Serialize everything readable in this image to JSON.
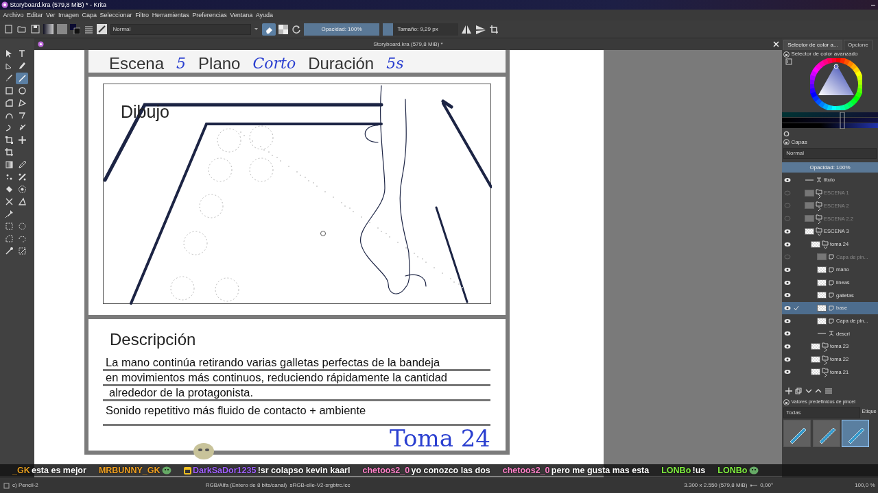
{
  "window": {
    "title": "Storyboard.kra (579,8 MiB) * - Krita"
  },
  "menu": [
    "Archivo",
    "Editar",
    "Ver",
    "Imagen",
    "Capa",
    "Seleccionar",
    "Filtro",
    "Herramientas",
    "Preferencias",
    "Ventana",
    "Ayuda"
  ],
  "toolbar": {
    "blend_mode": "Normal",
    "opacity": {
      "text": "Opacidad: 100%",
      "level": 1
    },
    "size": {
      "text": "Tamaño: 9,29 px",
      "level": 0.14
    }
  },
  "tools": [
    {
      "selected": false
    },
    {
      "selected": false
    },
    {
      "selected": false
    },
    {
      "selected": false
    },
    {
      "selected": false
    },
    {
      "selected": true
    },
    {
      "selected": false
    },
    {
      "selected": false
    },
    {
      "selected": false
    },
    {
      "selected": false
    },
    {
      "selected": false
    },
    {
      "selected": false
    },
    {
      "selected": false
    },
    {
      "selected": false
    },
    {
      "selected": false
    },
    {
      "selected": false
    },
    {
      "selected": false
    },
    {
      "selected": false
    },
    {
      "selected": false
    },
    {
      "selected": false
    },
    {
      "selected": false
    },
    {
      "selected": false
    },
    {
      "selected": false
    },
    {
      "selected": false
    },
    {
      "selected": false
    },
    {
      "selected": false
    },
    {
      "selected": false
    },
    {
      "selected": false
    },
    {
      "selected": false
    },
    {
      "selected": false
    },
    {
      "selected": false
    },
    {
      "selected": false
    }
  ],
  "document_tab": {
    "title": "Storyboard.kra (579,8 MiB) *"
  },
  "storyboard": {
    "header": [
      {
        "text": "Escena",
        "kind": "label"
      },
      {
        "text": "5",
        "kind": "handwriting"
      },
      {
        "text": "Plano",
        "kind": "label"
      },
      {
        "text": "Corto",
        "kind": "handwriting"
      },
      {
        "text": "Duración",
        "kind": "label"
      },
      {
        "text": "5s",
        "kind": "handwriting"
      }
    ],
    "drawing_label": "Dibujo",
    "description_title": "Descripción",
    "description_lines": [
      "La mano continúa retirando varias galletas perfectas de la bandeja",
      "en movimientos más continuos, reduciendo rápidamente la cantidad",
      "alrededor de la protagonista.",
      "Sonido repetitivo más fluido de contacto + ambiente"
    ],
    "shot": "Toma 24"
  },
  "dock": {
    "color_tabs": [
      {
        "label": "Selector de color a...",
        "selected": true
      },
      {
        "label": "Opcione",
        "selected": false
      }
    ],
    "color_title": "Selector de color avanzado",
    "layers_title": "Capas",
    "layers_blend": "Normal",
    "layers_opacity": {
      "text": "Opacidad:  100%",
      "level": 1
    },
    "layers": [
      {
        "name": "titulo",
        "kind": "vector",
        "visible": true,
        "selected": false
      },
      {
        "name": "ESCENA 1",
        "kind": "group",
        "visible": false,
        "selected": false,
        "expanded": false
      },
      {
        "name": "ESCENA 2",
        "kind": "group",
        "visible": false,
        "selected": false,
        "expanded": false
      },
      {
        "name": "ESCENA 2.2",
        "kind": "group",
        "visible": false,
        "selected": false,
        "expanded": false
      },
      {
        "name": "ESCENA 3",
        "kind": "group",
        "visible": true,
        "selected": false,
        "expanded": true,
        "children": [
          {
            "name": "toma 24",
            "kind": "group",
            "visible": true,
            "selected": false,
            "expanded": true,
            "children": [
              {
                "name": "Capa de pin...",
                "kind": "paint",
                "visible": false,
                "selected": false
              },
              {
                "name": "mano",
                "kind": "paint",
                "visible": true,
                "selected": false
              },
              {
                "name": "lineas",
                "kind": "paint",
                "visible": true,
                "selected": false
              },
              {
                "name": "galletas",
                "kind": "paint",
                "visible": true,
                "selected": false
              },
              {
                "name": "base",
                "kind": "paint",
                "visible": true,
                "selected": true
              },
              {
                "name": "Capa de pin...",
                "kind": "paint",
                "visible": true,
                "selected": false
              },
              {
                "name": "descri",
                "kind": "vector",
                "visible": true,
                "selected": false
              }
            ]
          },
          {
            "name": "toma 23",
            "kind": "group",
            "visible": true,
            "selected": false,
            "expanded": false
          },
          {
            "name": "toma 22",
            "kind": "group",
            "visible": true,
            "selected": false,
            "expanded": false
          },
          {
            "name": "toma 21",
            "kind": "group",
            "visible": true,
            "selected": false,
            "expanded": false
          }
        ]
      }
    ],
    "presets_title": "Valores predefinidos de pincel",
    "presets_filter": "Todas",
    "presets_tag": "Etique",
    "presets": [
      {
        "selected": false
      },
      {
        "selected": false
      },
      {
        "selected": true
      }
    ]
  },
  "chat": [
    {
      "user": "_GK",
      "color": "#e8a020",
      "text": "esta es mejor",
      "badge": false,
      "emote": false
    },
    {
      "user": "MRBUNNY_GK",
      "color": "#f0a020",
      "badge": false,
      "emote": true
    },
    {
      "user": "DarkSaDor1235",
      "color": "#a060ff",
      "text": "!sr colapso kevin kaarl",
      "badge": true,
      "emote": false
    },
    {
      "user": "chetoos2_0",
      "color": "#ff80c8",
      "text": "yo conozco las dos",
      "badge": false,
      "emote": false
    },
    {
      "user": "chetoos2_0",
      "color": "#ff80c8",
      "text": "pero me gusta mas esta",
      "badge": false,
      "emote": false
    },
    {
      "user": "LONBo",
      "color": "#80f040",
      "text": "!us",
      "badge": false,
      "emote": false
    },
    {
      "user": "LONBo",
      "color": "#80f040",
      "badge": false,
      "emote": true
    }
  ],
  "status_bar": {
    "tool": "c) Pencil-2",
    "color_space": "RGB/Alfa (Entero de 8 bits/canal)",
    "profile": "sRGB-elle-V2-srgbtrc.icc",
    "dimensions": "3.300 x 2.550 (579,8 MiB)",
    "rotation": "0,00°",
    "zoom": "100,0 %"
  }
}
